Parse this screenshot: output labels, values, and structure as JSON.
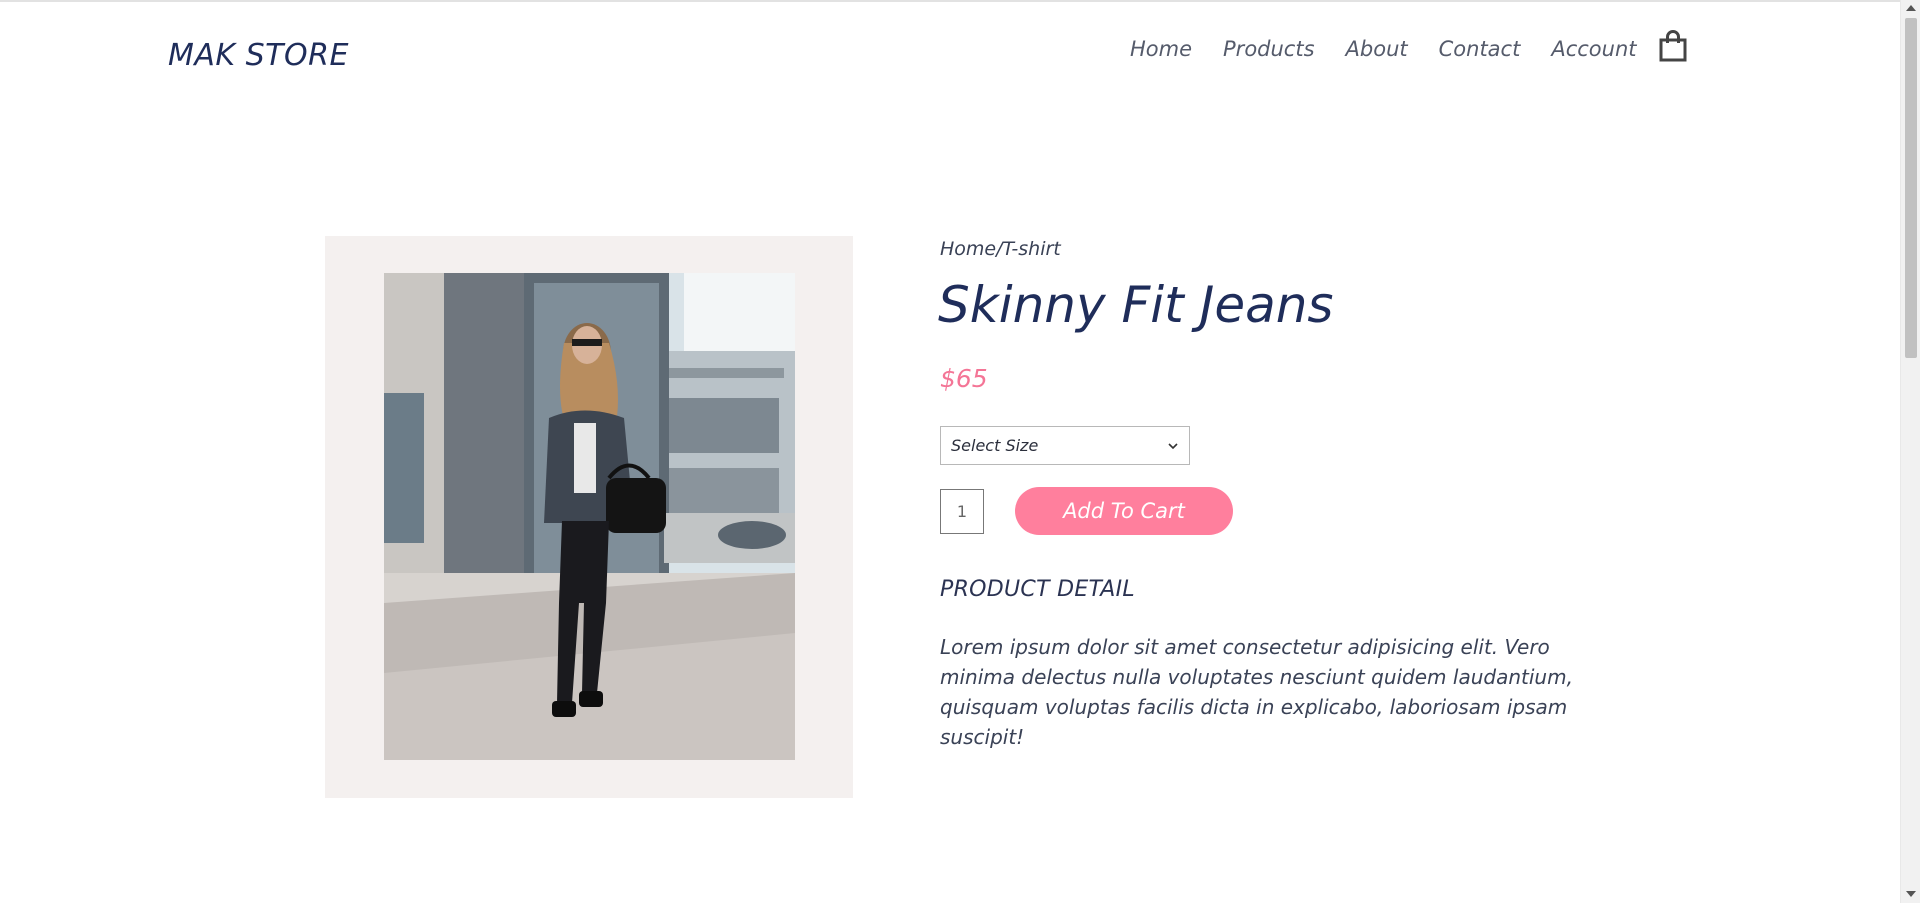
{
  "header": {
    "logo": "MAK STORE",
    "nav": [
      "Home",
      "Products",
      "About",
      "Contact",
      "Account"
    ],
    "cart_icon": "shopping-bag-icon"
  },
  "product": {
    "breadcrumb": "Home/T-shirt",
    "title": "Skinny Fit Jeans",
    "price": "$65",
    "size_select": "Select Size",
    "quantity": "1",
    "add_to_cart": "Add To Cart",
    "detail_heading": "PRODUCT DETAIL",
    "description": "Lorem ipsum dolor sit amet consectetur adipisicing elit. Vero minima delectus nulla voluptates nesciunt quidem laudantium, quisquam voluptas facilis dicta in explicabo, laboriosam ipsam suscipit!"
  },
  "colors": {
    "brand": "#1f2d5a",
    "accent": "#ff7f9d",
    "price": "#f47596",
    "image_bg": "#f4f0ef"
  }
}
